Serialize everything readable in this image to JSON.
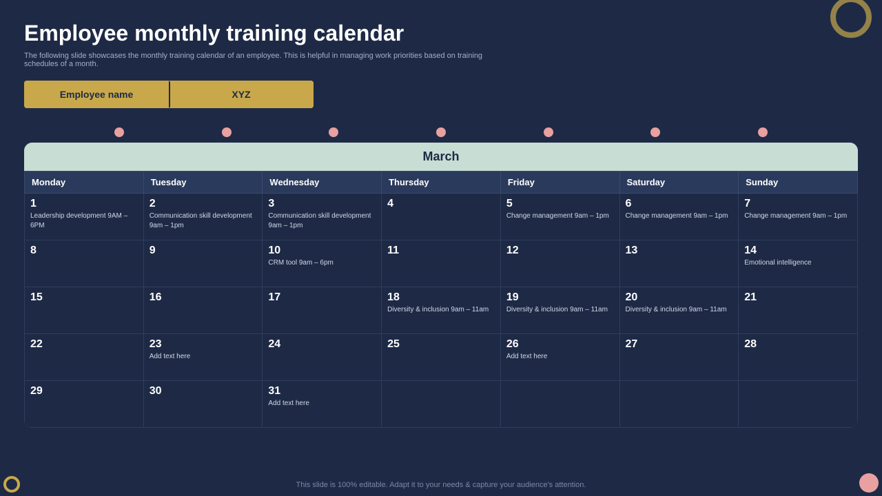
{
  "title": "Employee monthly training calendar",
  "subtitle": "The following slide showcases the monthly training calendar of an employee. This is helpful in managing  work priorities based on training schedules of a month.",
  "employee_label": "Employee name",
  "employee_value": "XYZ",
  "month": "March",
  "days_of_week": [
    "Monday",
    "Tuesday",
    "Wednesday",
    "Thursday",
    "Friday",
    "Saturday",
    "Sunday"
  ],
  "weeks": [
    [
      {
        "day": "1",
        "event": "Leadership development\n9AM – 6PM"
      },
      {
        "day": "2",
        "event": "Communication skill development\n9am – 1pm"
      },
      {
        "day": "3",
        "event": "Communication skill development\n9am – 1pm"
      },
      {
        "day": "4",
        "event": ""
      },
      {
        "day": "5",
        "event": "Change management\n9am – 1pm"
      },
      {
        "day": "6",
        "event": "Change management\n9am – 1pm"
      },
      {
        "day": "7",
        "event": "Change management\n9am – 1pm"
      }
    ],
    [
      {
        "day": "8",
        "event": ""
      },
      {
        "day": "9",
        "event": ""
      },
      {
        "day": "10",
        "event": "CRM tool\n9am – 6pm"
      },
      {
        "day": "11",
        "event": ""
      },
      {
        "day": "12",
        "event": ""
      },
      {
        "day": "13",
        "event": ""
      },
      {
        "day": "14",
        "event": "Emotional intelligence"
      }
    ],
    [
      {
        "day": "15",
        "event": ""
      },
      {
        "day": "16",
        "event": ""
      },
      {
        "day": "17",
        "event": ""
      },
      {
        "day": "18",
        "event": "Diversity & inclusion\n9am – 11am"
      },
      {
        "day": "19",
        "event": "Diversity & inclusion\n9am – 11am"
      },
      {
        "day": "20",
        "event": "Diversity & inclusion\n9am – 11am"
      },
      {
        "day": "21",
        "event": ""
      }
    ],
    [
      {
        "day": "22",
        "event": ""
      },
      {
        "day": "23",
        "event": "Add text here"
      },
      {
        "day": "24",
        "event": ""
      },
      {
        "day": "25",
        "event": ""
      },
      {
        "day": "26",
        "event": "Add text here"
      },
      {
        "day": "27",
        "event": ""
      },
      {
        "day": "28",
        "event": ""
      }
    ],
    [
      {
        "day": "29",
        "event": ""
      },
      {
        "day": "30",
        "event": ""
      },
      {
        "day": "31",
        "event": "Add text here"
      },
      {
        "day": "",
        "event": ""
      },
      {
        "day": "",
        "event": ""
      },
      {
        "day": "",
        "event": ""
      },
      {
        "day": "",
        "event": ""
      }
    ]
  ],
  "footer": "This slide is 100% editable. Adapt it to your needs & capture your audience's attention.",
  "timeline_dot_count": 7
}
